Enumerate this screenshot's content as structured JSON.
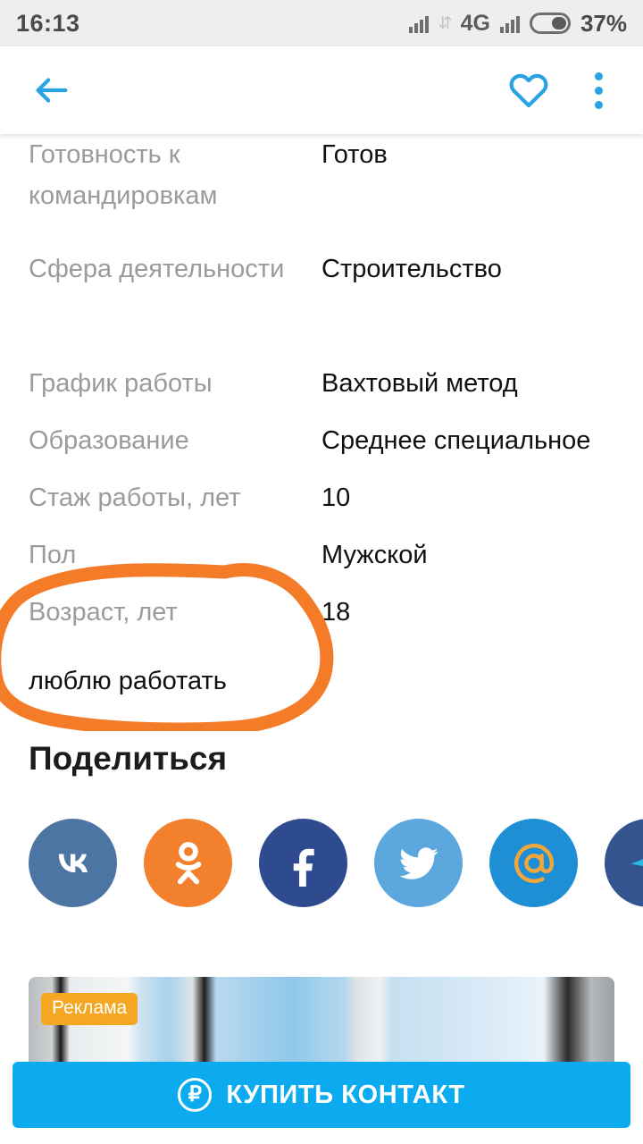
{
  "status_bar": {
    "time": "16:13",
    "network_label": "4G",
    "battery_percent": "37%",
    "icons": [
      "signal-bars-icon",
      "data-transfer-icon",
      "signal-bars-icon",
      "battery-icon"
    ]
  },
  "app_bar": {
    "back_icon": "back-arrow-icon",
    "favorite_icon": "heart-outline-icon",
    "menu_icon": "overflow-menu-icon",
    "accent_color": "#29a3e3"
  },
  "details": {
    "rows": [
      {
        "label": "Готовность к командировкам",
        "value": "Готов"
      },
      {
        "label": "Сфера деятельности",
        "value": "Строительство"
      },
      {
        "label": "График работы",
        "value": "Вахтовый метод"
      },
      {
        "label": "Образование",
        "value": "Среднее специальное"
      },
      {
        "label": "Стаж работы, лет",
        "value": "10"
      },
      {
        "label": "Пол",
        "value": "Мужской"
      },
      {
        "label": "Возраст, лет",
        "value": "18"
      }
    ],
    "free_text": "люблю работать"
  },
  "annotation": {
    "type": "hand-drawn-circle",
    "color": "#f47b28",
    "target_text": "люблю работать"
  },
  "share": {
    "title": "Поделиться",
    "buttons": [
      {
        "name": "vkontakte",
        "glyph": "VK",
        "bg": "#4c75a3"
      },
      {
        "name": "odnoklassniki",
        "glyph": "OK",
        "bg": "#f2802d"
      },
      {
        "name": "facebook",
        "glyph": "f",
        "bg": "#2d4b8e"
      },
      {
        "name": "twitter",
        "glyph": "t",
        "bg": "#5ba7de"
      },
      {
        "name": "mail-ru",
        "glyph": "@",
        "bg": "#1e8fd5"
      },
      {
        "name": "telegram",
        "glyph": "tg",
        "bg": "#34548f"
      }
    ]
  },
  "ad": {
    "label": "Реклама"
  },
  "cta": {
    "currency_symbol": "₽",
    "label": "КУПИТЬ КОНТАКТ",
    "color": "#0cabf0"
  }
}
